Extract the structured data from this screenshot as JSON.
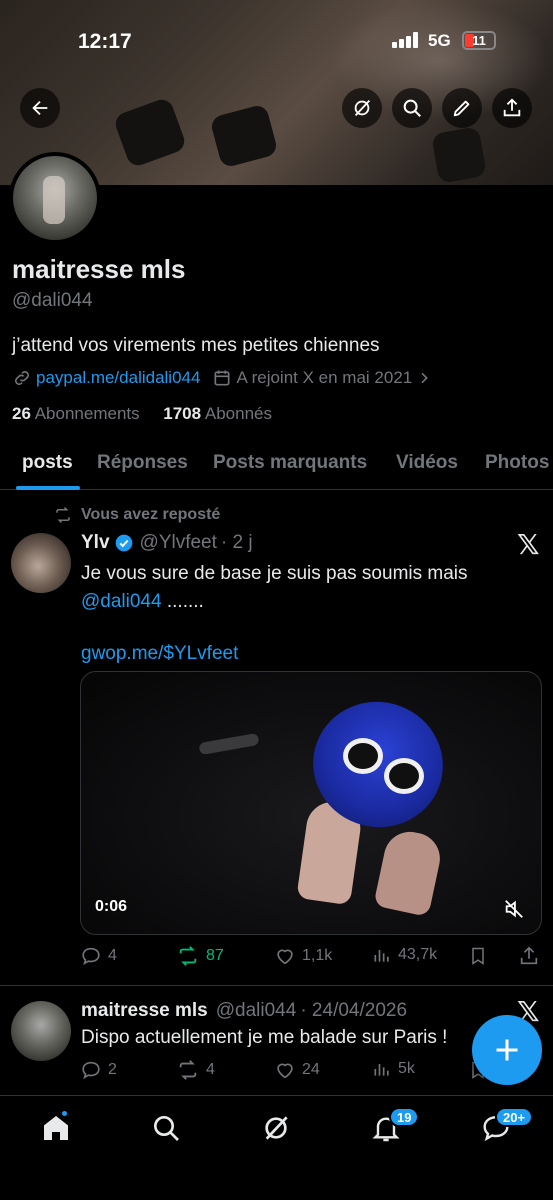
{
  "status_bar": {
    "time": "12:17",
    "network": "5G",
    "battery": "11"
  },
  "header": {
    "back_label": "Back",
    "icons": [
      "back-arrow-icon",
      "grok-icon",
      "search-icon",
      "edit-icon",
      "share-icon"
    ]
  },
  "profile": {
    "name": "maitresse mls",
    "handle": "@dali044",
    "bio": "j’attend vos virements mes petites chiennes",
    "link": "paypal.me/dalidali044",
    "joined": "A rejoint X en mai 2021",
    "following_count": "26",
    "following_label": "Abonnements",
    "followers_count": "1708",
    "followers_label": "Abonnés"
  },
  "tabs": [
    {
      "label": "posts",
      "active": true
    },
    {
      "label": "Réponses"
    },
    {
      "label": "Posts marquants"
    },
    {
      "label": "Vidéos"
    },
    {
      "label": "Photos"
    }
  ],
  "posts": [
    {
      "repost_label": "Vous avez reposté",
      "author": "Ylv",
      "handle": "@Ylvfeet",
      "time": "· 2 j",
      "text_line1": "Je vous sure de base je suis pas soumis mais",
      "mention": "@dali044",
      "text_after_mention": " .......",
      "link": "gwop.me/$YLvfeet",
      "video_duration": "0:06",
      "stats": {
        "replies": "4",
        "reposts": "87",
        "likes": "1,1k",
        "views": "43,7k"
      }
    },
    {
      "author": "maitresse mls",
      "handle": "@dali044",
      "time": "· 24/04/2026",
      "text": "Dispo actuellement je me balade sur Paris !",
      "stats": {
        "replies": "2",
        "reposts": "4",
        "likes": "24",
        "views": "5k"
      }
    }
  ],
  "bottom_nav": {
    "notifications_badge": "19",
    "messages_badge": "20+"
  },
  "colors": {
    "accent": "#1d9bf0",
    "repost_green": "#00ba7c",
    "muted": "#71767b"
  }
}
